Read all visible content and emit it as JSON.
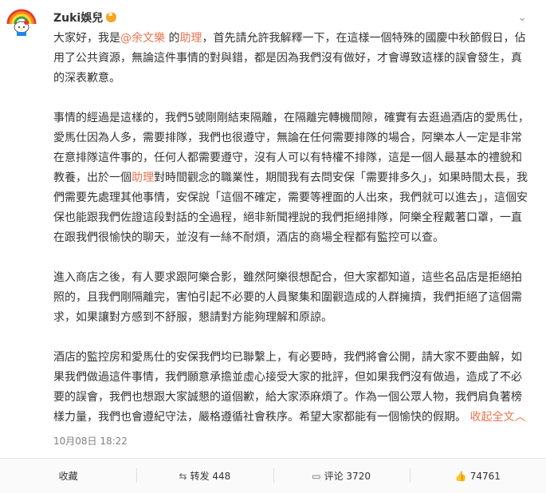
{
  "post": {
    "username": "Zuki娛兒",
    "more": "⌄",
    "paragraphs": [
      {
        "parts": [
          {
            "t": "大家好，我是"
          },
          {
            "t": "@余文樂",
            "k": "at"
          },
          {
            "t": " 的"
          },
          {
            "t": "助理",
            "k": "link"
          },
          {
            "t": "，首先請允許我解釋一下，在這樣一個特殊的國慶中秋節假日，佔用了公共資源，無論這件事情的對與錯，都是因為我們沒有做好，才會導致這樣的誤會發生，真的深表歉意。"
          }
        ]
      },
      {
        "parts": [
          {
            "t": "事情的經過是這樣的，我們5號剛剛結束隔離，在隔離完轉機間隙，確實有去逛過酒店的愛馬仕，愛馬仕因為人多，需要排隊，我們也很遵守，無論在任何需要排隊的場合，阿樂本人一定是非常在意排隊這件事的，任何人都需要遵守，沒有人可以有特權不排隊，這是一個人最基本的禮貌和教養，出於一個"
          },
          {
            "t": "助理",
            "k": "link"
          },
          {
            "t": "對時間觀念的職業性，期間我有去問安保「需要排多久」，如果時間太長，我們需要先處理其他事情，安保說「這個不確定，需要等裡面的人出來，我們就可以進去」，這個安保也能跟我們佐證這段對話的全過程，絕非新聞裡說的我們拒絕排隊，阿樂全程戴著口罩，一直在跟我們很愉快的聊天，並沒有一絲不耐煩，酒店的商場全程都有監控可以查。"
          }
        ]
      },
      {
        "parts": [
          {
            "t": "進入商店之後，有人要求跟阿樂合影，雖然阿樂很想配合，但大家都知道，這些名品店是拒絕拍照的，且我們剛隔離完，害怕引起不必要的人員聚集和圍觀造成的人群擁擠，我們拒絕了這個需求，如果讓對方感到不舒服，懇請對方能夠理解和原諒。"
          }
        ]
      },
      {
        "parts": [
          {
            "t": "酒店的監控房和愛馬仕的安保我們均已聯繫上，有必要時，我們將會公開，請大家不要曲解，如果我們做過這件事情，我們願意承擔並虛心接受大家的批評，但如果我們沒有做過，造成了不必要的誤會，我們也想跟大家誠懇的道個歉，給大家添麻煩了。作為一個公眾人物，我們肩負著榜樣力量，我們也會遵紀守法，嚴格遵循社會秩序。希望大家都能有一個愉快的假期。 "
          },
          {
            "t": "收起全文︿",
            "k": "collapse"
          }
        ]
      }
    ],
    "timestamp": "10月08日 18:22"
  },
  "actions": {
    "favorite": "收藏",
    "repost": "转发 448",
    "comment": "评论 3720",
    "like": "74761"
  }
}
